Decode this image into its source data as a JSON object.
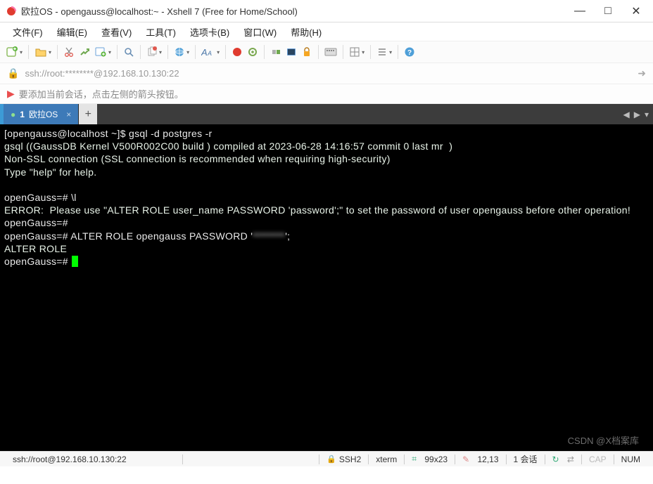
{
  "window": {
    "title": "欧拉OS - opengauss@localhost:~ - Xshell 7 (Free for Home/School)"
  },
  "menu": {
    "items": [
      "文件(F)",
      "编辑(E)",
      "查看(V)",
      "工具(T)",
      "选项卡(B)",
      "窗口(W)",
      "帮助(H)"
    ]
  },
  "address": {
    "url": "ssh://root:********@192.168.10.130:22"
  },
  "hint": {
    "text": "要添加当前会话，点击左侧的箭头按钮。"
  },
  "tabs": {
    "active_idx": "1",
    "active_label": "欧拉OS"
  },
  "terminal": {
    "lines": [
      {
        "t": "shell",
        "user": "[opengauss@localhost ~]$ ",
        "cmd": "gsql -d postgres -r"
      },
      {
        "t": "out",
        "text": "gsql ((GaussDB Kernel V500R002C00 build ) compiled at 2023-06-28 14:16:57 commit 0 last mr  )"
      },
      {
        "t": "out",
        "text": "Non-SSL connection (SSL connection is recommended when requiring high-security)"
      },
      {
        "t": "out",
        "text": "Type \"help\" for help."
      },
      {
        "t": "blank"
      },
      {
        "t": "gauss",
        "prompt": "openGauss=# ",
        "cmd": "\\l"
      },
      {
        "t": "out",
        "text": "ERROR:  Please use \"ALTER ROLE user_name PASSWORD 'password';\" to set the password of user opengauss before other operation!"
      },
      {
        "t": "gauss",
        "prompt": "openGauss=# ",
        "cmd": ""
      },
      {
        "t": "gauss-blur",
        "prompt": "openGauss=# ",
        "cmd_pre": "ALTER ROLE opengauss PASSWORD '",
        "blur": "********",
        "cmd_post": "';"
      },
      {
        "t": "out",
        "text": "ALTER ROLE"
      },
      {
        "t": "gauss-cursor",
        "prompt": "openGauss=# "
      }
    ]
  },
  "watermark": "CSDN @X档案库",
  "status": {
    "conn": "ssh://root@192.168.10.130:22",
    "proto": "SSH2",
    "term": "xterm",
    "size": "99x23",
    "pos": "12,13",
    "sessions": "1 会话",
    "cap": "CAP",
    "num": "NUM"
  }
}
